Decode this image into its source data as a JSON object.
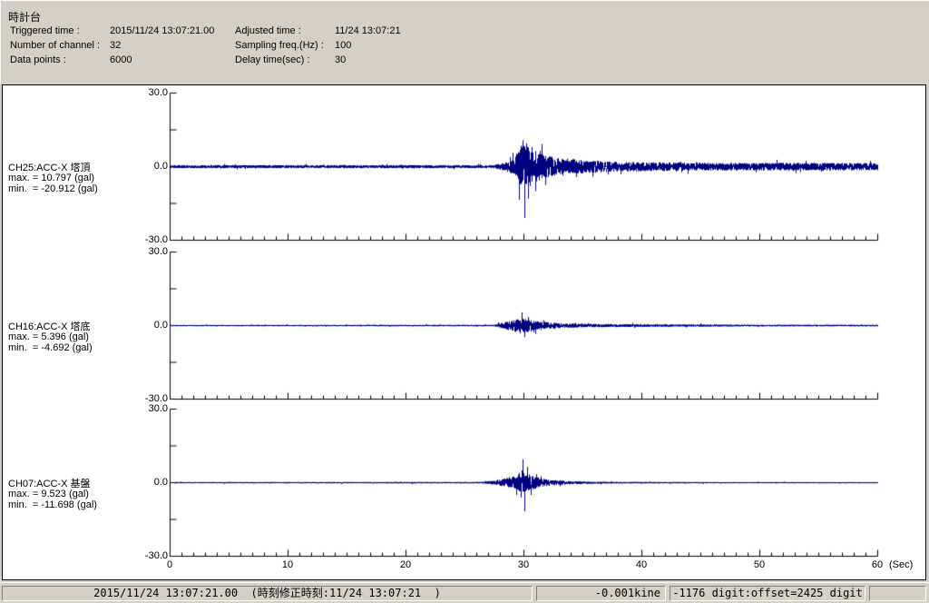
{
  "header": {
    "title": "時計台",
    "fields": [
      {
        "label": "Triggered time :",
        "value": "2015/11/24 13:07:21.00"
      },
      {
        "label": "Adjusted time :",
        "value": "11/24 13:07:21"
      },
      {
        "label": "Number of channel :",
        "value": "32"
      },
      {
        "label": "Sampling freq.(Hz) :",
        "value": "100"
      },
      {
        "label": "Data points :",
        "value": "6000"
      },
      {
        "label": "Delay time(sec) :",
        "value": "30"
      }
    ]
  },
  "chart_data": {
    "type": "line",
    "title": "",
    "x_axis": {
      "label": "(Sec)",
      "min": 0,
      "max": 60,
      "major_tick_sec": 10,
      "minor_tick_sec": 1,
      "tick_labels": [
        "0",
        "10",
        "20",
        "30",
        "40",
        "50",
        "60"
      ]
    },
    "y_axis": {
      "min": -30,
      "max": 30,
      "unit": "gal",
      "tick_labels": [
        "30.0",
        "0.0",
        "-30.0"
      ],
      "minor_ticks": [
        15,
        -15
      ]
    },
    "colors": {
      "trace": "#000080",
      "zero_line": "#008000",
      "axis": "#000000"
    },
    "channels": [
      {
        "label": "CH25:ACC-X 塔頂",
        "max_text": "max. = 10.797 (gal)",
        "min_text": "min.  = -20.912 (gal)",
        "max_gal": 10.797,
        "min_gal": -20.912,
        "seed": 11,
        "envelope": [
          [
            0,
            0.5
          ],
          [
            27.3,
            0.5
          ],
          [
            28.2,
            1.2
          ],
          [
            29.0,
            2.5
          ],
          [
            29.6,
            6
          ],
          [
            30.0,
            7.5
          ],
          [
            30.6,
            6
          ],
          [
            31.5,
            4
          ],
          [
            33,
            2.8
          ],
          [
            35,
            2.2
          ],
          [
            38,
            1.6
          ],
          [
            45,
            1.3
          ],
          [
            60,
            1.2
          ]
        ],
        "peaks": [
          [
            29.5,
            -13.5
          ],
          [
            29.7,
            8.5
          ],
          [
            29.85,
            10.797
          ],
          [
            30.0,
            -20.912
          ],
          [
            30.15,
            9.5
          ],
          [
            30.3,
            -13
          ],
          [
            30.6,
            8
          ],
          [
            30.9,
            -10
          ],
          [
            31.3,
            6.5
          ],
          [
            31.8,
            -7.5
          ]
        ]
      },
      {
        "label": "CH16:ACC-X 塔底",
        "max_text": "max. = 5.396 (gal)",
        "min_text": "min.  = -4.692 (gal)",
        "max_gal": 5.396,
        "min_gal": -4.692,
        "seed": 22,
        "envelope": [
          [
            0,
            0.22
          ],
          [
            27.3,
            0.25
          ],
          [
            28.2,
            1.0
          ],
          [
            29.3,
            2.2
          ],
          [
            30.3,
            2.2
          ],
          [
            31.2,
            1.3
          ],
          [
            33,
            0.8
          ],
          [
            36,
            0.55
          ],
          [
            42,
            0.4
          ],
          [
            50,
            0.3
          ],
          [
            60,
            0.28
          ]
        ],
        "peaks": [
          [
            29.6,
            -3.2
          ],
          [
            29.8,
            5.396
          ],
          [
            30.0,
            -4.692
          ],
          [
            30.3,
            3.5
          ],
          [
            30.8,
            -2.8
          ]
        ]
      },
      {
        "label": "CH07:ACC-X 基盤",
        "max_text": "max. = 9.523 (gal)",
        "min_text": "min.  = -11.698 (gal)",
        "max_gal": 9.523,
        "min_gal": -11.698,
        "seed": 33,
        "envelope": [
          [
            0,
            0.2
          ],
          [
            26.3,
            0.25
          ],
          [
            27.5,
            0.7
          ],
          [
            29.2,
            2.2
          ],
          [
            29.9,
            3.5
          ],
          [
            30.5,
            2.5
          ],
          [
            31.3,
            1.4
          ],
          [
            32.5,
            0.9
          ],
          [
            34,
            0.5
          ],
          [
            37,
            0.3
          ],
          [
            45,
            0.2
          ],
          [
            60,
            0.18
          ]
        ],
        "peaks": [
          [
            29.5,
            4
          ],
          [
            29.7,
            -6
          ],
          [
            29.85,
            9.523
          ],
          [
            30.0,
            -11.698
          ],
          [
            30.2,
            6
          ],
          [
            30.5,
            -5
          ],
          [
            31.0,
            3.5
          ]
        ]
      }
    ]
  },
  "status_bar": {
    "time_text": "2015/11/24 13:07:21.00  (時刻修正時刻:11/24 13:07:21  )",
    "kine_text": "-0.001kine",
    "digit_text": "-1176 digit:offset=2425 digit",
    "extra_text": ""
  }
}
